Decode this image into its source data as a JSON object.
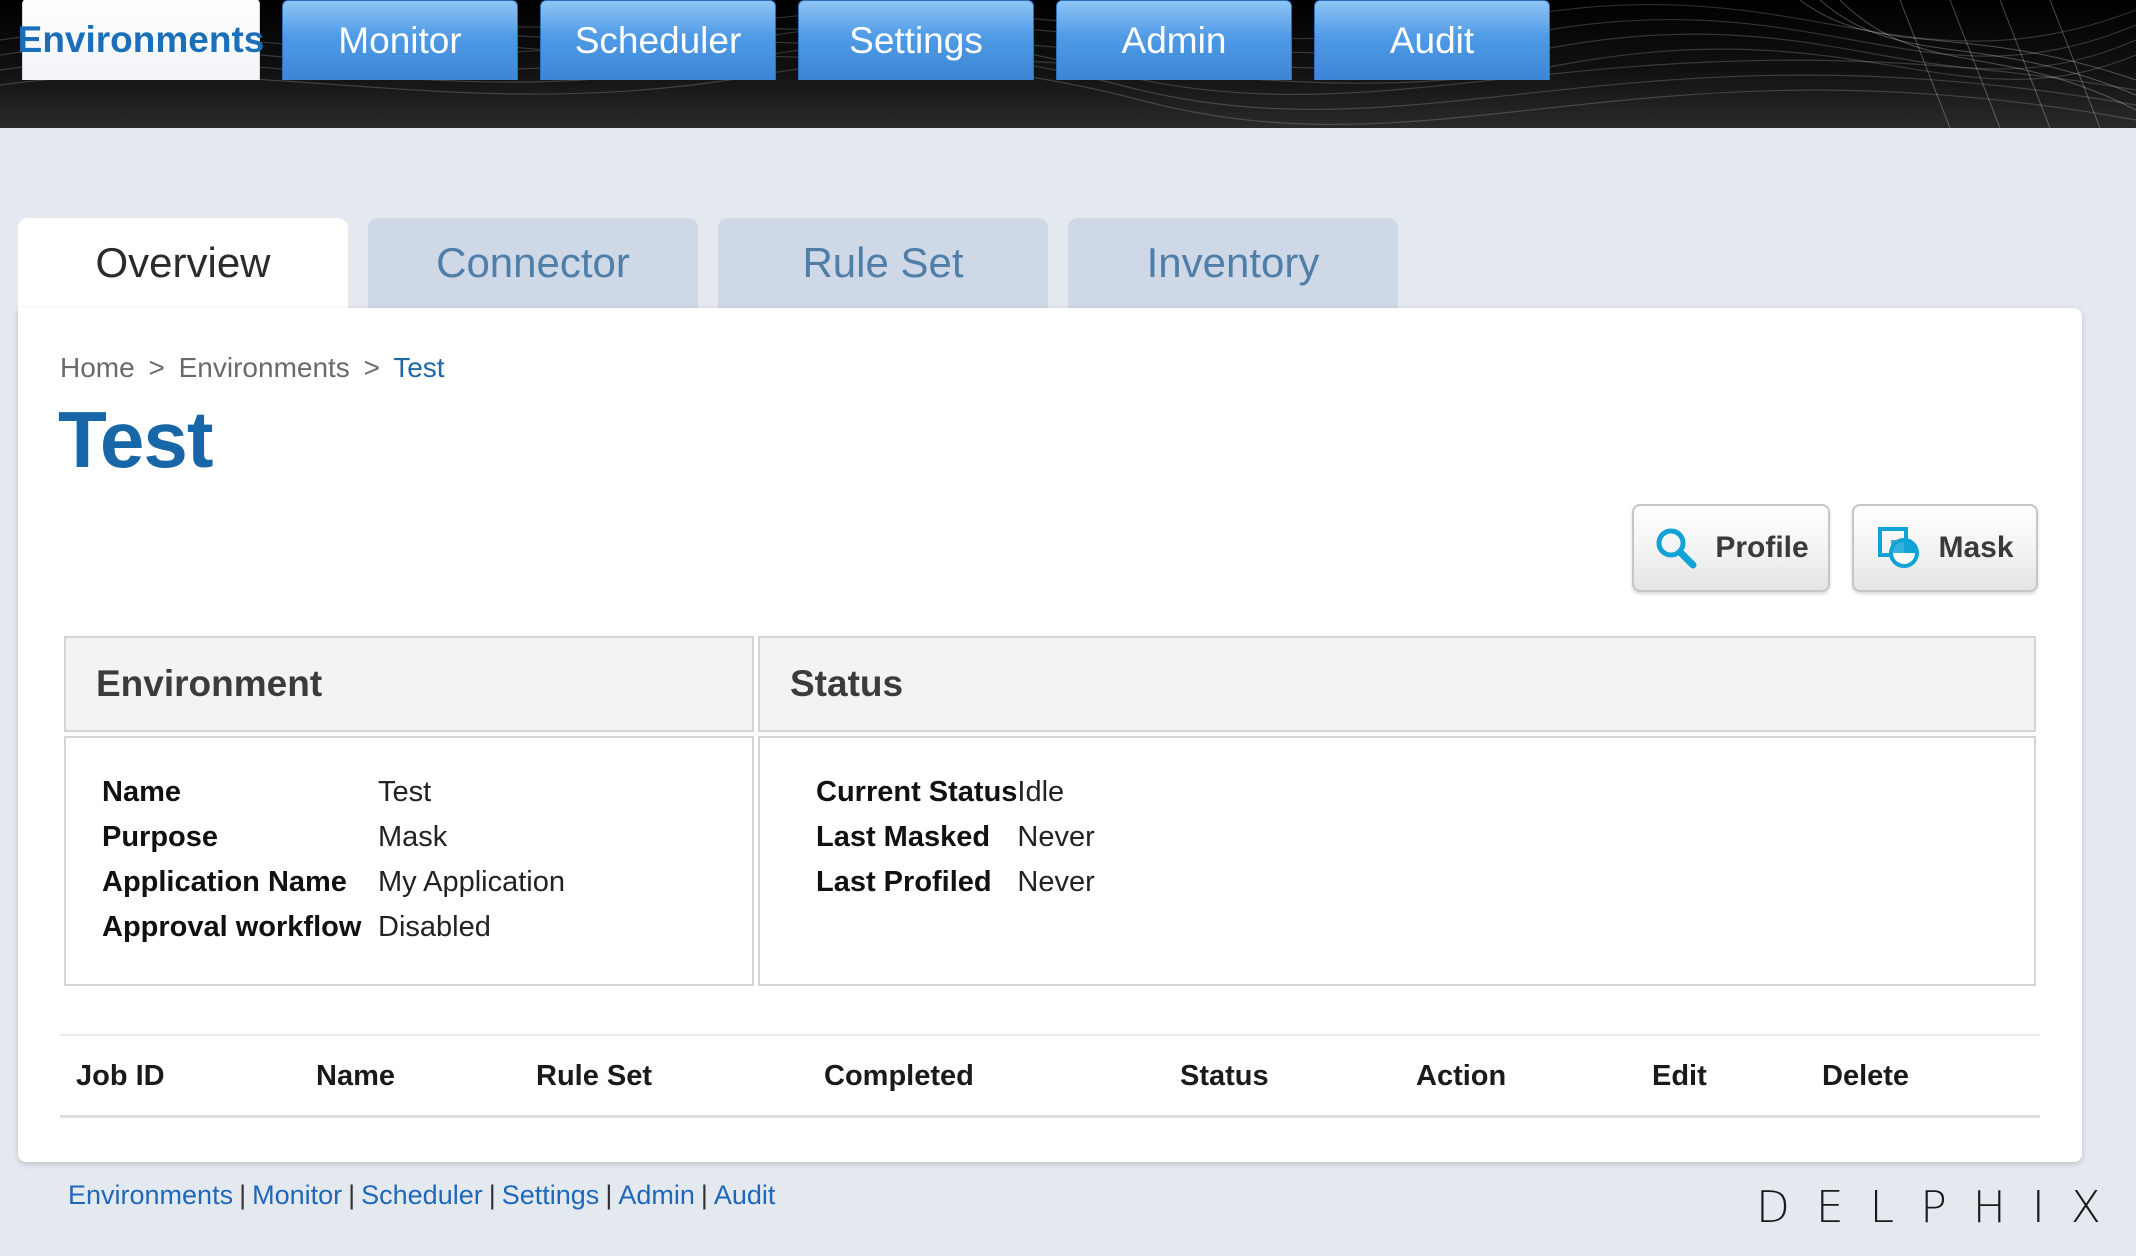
{
  "top_nav": {
    "tabs": [
      {
        "label": "Environments",
        "active": true
      },
      {
        "label": "Monitor",
        "active": false
      },
      {
        "label": "Scheduler",
        "active": false
      },
      {
        "label": "Settings",
        "active": false
      },
      {
        "label": "Admin",
        "active": false
      },
      {
        "label": "Audit",
        "active": false
      }
    ]
  },
  "sub_nav": {
    "tabs": [
      {
        "label": "Overview",
        "active": true
      },
      {
        "label": "Connector",
        "active": false
      },
      {
        "label": "Rule Set",
        "active": false
      },
      {
        "label": "Inventory",
        "active": false
      }
    ]
  },
  "breadcrumb": {
    "items": [
      "Home",
      "Environments",
      "Test"
    ],
    "separator": ">"
  },
  "page": {
    "title": "Test"
  },
  "actions": {
    "profile_label": "Profile",
    "mask_label": "Mask",
    "profile_icon": "search-icon",
    "mask_icon": "mask-icon"
  },
  "environment_card": {
    "title": "Environment",
    "rows": [
      {
        "key": "Name",
        "value": "Test"
      },
      {
        "key": "Purpose",
        "value": "Mask"
      },
      {
        "key": "Application Name",
        "value": "My Application"
      },
      {
        "key": "Approval workflow",
        "value": "Disabled"
      }
    ]
  },
  "status_card": {
    "title": "Status",
    "rows": [
      {
        "key": "Current Status",
        "value": "Idle"
      },
      {
        "key": "Last Masked",
        "value": "Never"
      },
      {
        "key": "Last Profiled",
        "value": "Never"
      }
    ]
  },
  "jobs_table": {
    "columns": [
      "Job ID",
      "Name",
      "Rule Set",
      "Completed",
      "Status",
      "Action",
      "Edit",
      "Delete"
    ]
  },
  "footer": {
    "links": [
      "Environments",
      "Monitor",
      "Scheduler",
      "Settings",
      "Admin",
      "Audit"
    ],
    "separator": "|",
    "brand": "DELPHIX"
  },
  "colors": {
    "accent_blue": "#1666a8",
    "tab_blue": "#4f9be6",
    "link_blue": "#1f67b8",
    "icon_cyan": "#11a3d6"
  }
}
